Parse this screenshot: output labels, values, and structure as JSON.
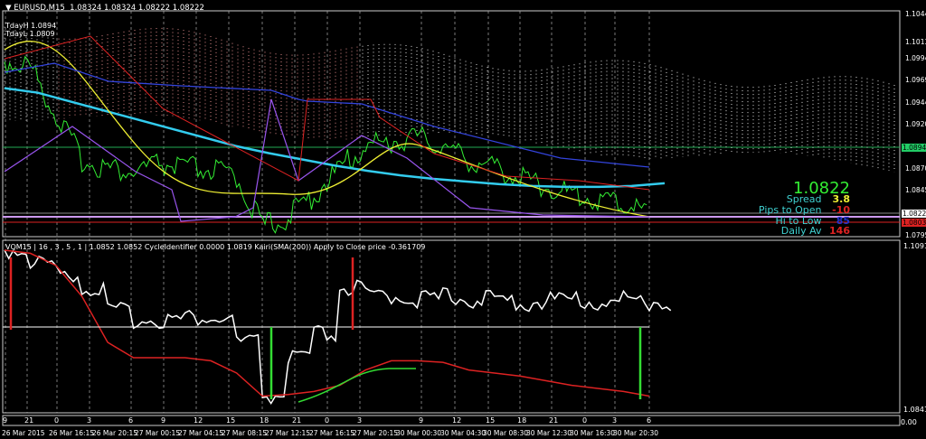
{
  "header": {
    "symbol": "EURUSD,M15",
    "ohlc": "1.08324 1.08324 1.08222 1.08222",
    "today_high": "TdayH 1.0894",
    "today_low": "TdayL 1.0809"
  },
  "info_panel": {
    "price": "1.0822",
    "spread_label": "Spread",
    "spread_value": "3.8",
    "pips_label": "Pips to Open",
    "pips_value": "-10",
    "hilo_label": "Hi to Low",
    "hilo_value": "85",
    "daily_label": "Daily Av",
    "daily_value": "146"
  },
  "price_axis": {
    "ticks": [
      "1.10440",
      "1.10130",
      "1.09945",
      "1.09695",
      "1.09445",
      "1.09200",
      "1.08700",
      "1.08455",
      "1.07950"
    ],
    "tag_green": "1.08941",
    "tag_white": "1.08222",
    "tag_red": "1.08032"
  },
  "sub_window": {
    "title": "VQM15 | 16 , 3 , 5 , 1 | 1.0852 1.0852 CycleIdentifier 0.0000 1.0819 Kairi(SMA(200)) Apply to Close price -0.361709",
    "axis_top": "1.1091",
    "axis_bottom": "1.0841"
  },
  "hour_axis": {
    "labels": [
      "9",
      "21",
      "0",
      "3",
      "6",
      "9",
      "12",
      "15",
      "18",
      "21",
      "0",
      "3",
      "9",
      "12",
      "15",
      "18",
      "21",
      "0",
      "3",
      "6"
    ],
    "right": "0.00"
  },
  "time_axis": [
    "26 Mar 2015",
    "26 Mar 16:15",
    "26 Mar 20:15",
    "27 Mar 00:15",
    "27 Mar 04:15",
    "27 Mar 08:15",
    "27 Mar 12:15",
    "27 Mar 16:15",
    "27 Mar 20:15",
    "30 Mar 00:30",
    "30 Mar 04:30",
    "30 Mar 08:30",
    "30 Mar 12:30",
    "30 Mar 16:30",
    "30 Mar 20:30"
  ],
  "colors": {
    "bg": "#000000",
    "price": "#33ee33",
    "ma_slow": "#33ccee",
    "ma_fast": "#eeee33",
    "cloud": "#e0e0e0",
    "red": "#dd2222",
    "purple": "#9955ee",
    "blue": "#3344dd",
    "osc": "#ffffff"
  },
  "chart_data": {
    "type": "line",
    "title": "EURUSD,M15",
    "ylim": [
      1.0795,
      1.1044
    ],
    "close": [
      1.099,
      1.0985,
      1.093,
      1.088,
      1.087,
      1.0865,
      1.0875,
      1.087,
      1.0868,
      1.086,
      1.0805,
      1.0815,
      1.084,
      1.087,
      1.0895,
      1.09,
      1.0905,
      1.0895,
      1.088,
      1.087,
      1.086,
      1.085,
      1.084,
      1.0835,
      1.083,
      1.0822
    ],
    "ma_slow": [
      1.096,
      1.0955,
      1.0945,
      1.0935,
      1.0925,
      1.0915,
      1.0905,
      1.0895,
      1.0887,
      1.088,
      1.0873,
      1.0867,
      1.0862,
      1.0858,
      1.0855,
      1.0852,
      1.085,
      1.0849,
      1.0849,
      1.085,
      1.0853
    ],
    "oscillator_ylim": [
      1.0841,
      1.1091
    ],
    "osc_white": [
      100,
      92,
      85,
      75,
      60,
      55,
      55,
      56,
      55,
      40,
      5,
      30,
      45,
      75,
      70,
      70,
      68,
      70,
      68,
      67,
      66,
      68,
      67,
      66,
      68,
      66
    ],
    "osc_red": [
      100,
      98,
      90,
      70,
      40,
      30,
      30,
      30,
      28,
      20,
      5,
      6,
      8,
      12,
      22,
      28,
      28,
      27,
      22,
      20,
      18,
      15,
      12,
      10,
      8,
      5
    ]
  }
}
